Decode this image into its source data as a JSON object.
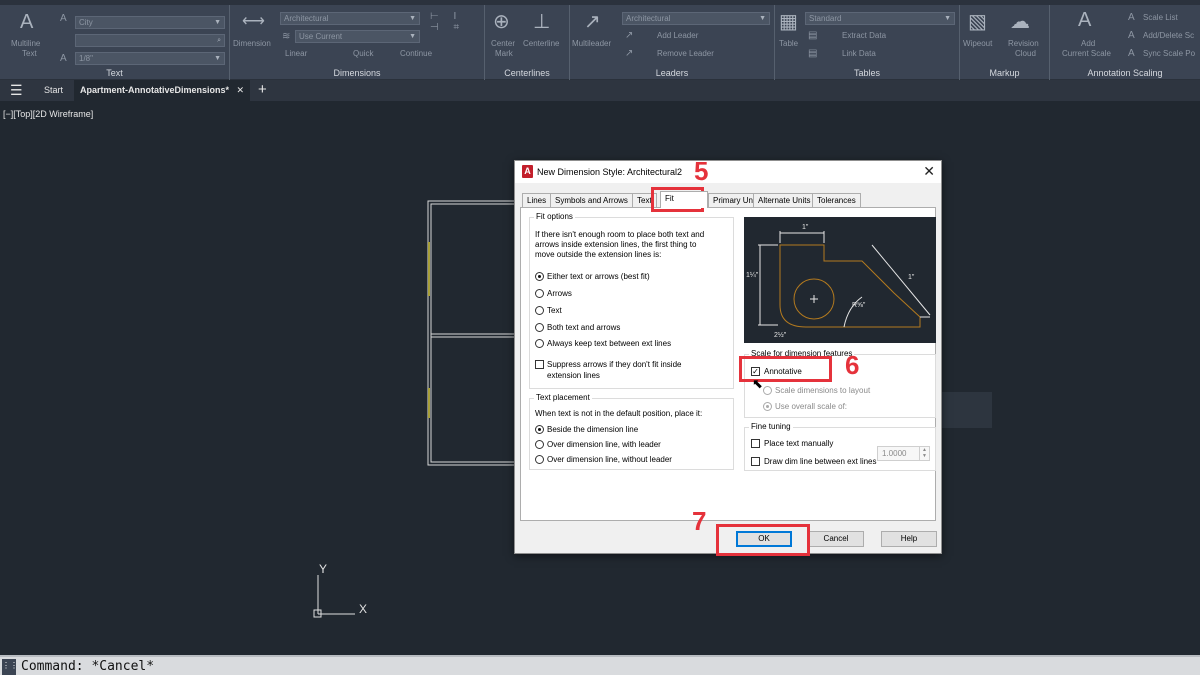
{
  "ribbon": {
    "text_panel": {
      "title": "Text",
      "multiline_label": "Multiline",
      "multiline_label2": "Text",
      "style_combo": "City",
      "height_combo": "1/8\""
    },
    "dimensions_panel": {
      "title": "Dimensions",
      "dimension_label": "Dimension",
      "style_combo": "Architectural",
      "layer_combo": "Use Current",
      "linear_label": "Linear",
      "quick_label": "Quick",
      "continue_label": "Continue"
    },
    "centerlines_panel": {
      "title": "Centerlines",
      "center_mark_label": "Center",
      "center_mark_label2": "Mark",
      "centerline_label": "Centerline"
    },
    "leaders_panel": {
      "title": "Leaders",
      "multileader_label": "Multileader",
      "style_combo": "Architectural",
      "add_leader_label": "Add Leader",
      "remove_leader_label": "Remove Leader"
    },
    "tables_panel": {
      "title": "Tables",
      "table_label": "Table",
      "style_combo": "Standard",
      "extract_label": "Extract Data",
      "link_label": "Link Data"
    },
    "markup_panel": {
      "title": "Markup",
      "wipeout_label": "Wipeout",
      "revision_label": "Revision",
      "revision_label2": "Cloud"
    },
    "annotation_scaling_panel": {
      "title": "Annotation Scaling",
      "add_scale_label": "Add",
      "add_scale_label2": "Current Scale",
      "scale_list_label": "Scale List",
      "add_delete_label": "Add/Delete Sc",
      "sync_label": "Sync Scale Po"
    }
  },
  "tabbar": {
    "start_label": "Start",
    "file_tab_label": "Apartment-AnnotativeDimensions*",
    "close_glyph": "✕",
    "plus_glyph": "+"
  },
  "viewport": {
    "label": "[−][Top][2D Wireframe]",
    "ucs_y": "Y",
    "ucs_x": "X"
  },
  "command": {
    "text": "Command: *Cancel*"
  },
  "dialog": {
    "title": "New Dimension Style: Architectural2",
    "icon_letter": "A",
    "tabs": [
      "Lines",
      "Symbols and Arrows",
      "Text",
      "Fit",
      "Primary Units",
      "Alternate Units",
      "Tolerances"
    ],
    "fit_options": {
      "label": "Fit options",
      "description": [
        "If there isn't enough room to place both text and",
        "arrows inside extension lines, the first thing to",
        "move outside the extension lines is:"
      ],
      "radios": [
        "Either text or arrows (best fit)",
        "Arrows",
        "Text",
        "Both text and arrows",
        "Always keep text between ext lines"
      ],
      "selected_index": 0,
      "suppress_label": [
        "Suppress arrows if they don't fit inside",
        "extension lines"
      ]
    },
    "text_placement": {
      "label": "Text placement",
      "description": "When text is not in the default position, place it:",
      "radios": [
        "Beside the dimension line",
        "Over dimension line, with leader",
        "Over dimension line, without leader"
      ],
      "selected_index": 0
    },
    "scale": {
      "label": "Scale for dimension features",
      "annotative_label": "Annotative",
      "annotative_checked": true,
      "scale_to_layout_label": "Scale dimensions to layout",
      "overall_label": "Use overall scale of:",
      "overall_value": "1.0000"
    },
    "fine_tuning": {
      "label": "Fine tuning",
      "place_manually_label": "Place text manually",
      "draw_dim_line_label": "Draw dim line between ext lines"
    },
    "preview": {
      "dim_top": "1\"",
      "dim_left": "1¼\"",
      "dim_bottom": "2½\"",
      "dim_diag": "1\"",
      "dim_arc": "R⅝\""
    },
    "buttons": {
      "ok": "OK",
      "cancel": "Cancel",
      "help": "Help"
    }
  },
  "annotations": {
    "step5": "5",
    "step6": "6",
    "step7": "7",
    "color": "#e5323b"
  }
}
